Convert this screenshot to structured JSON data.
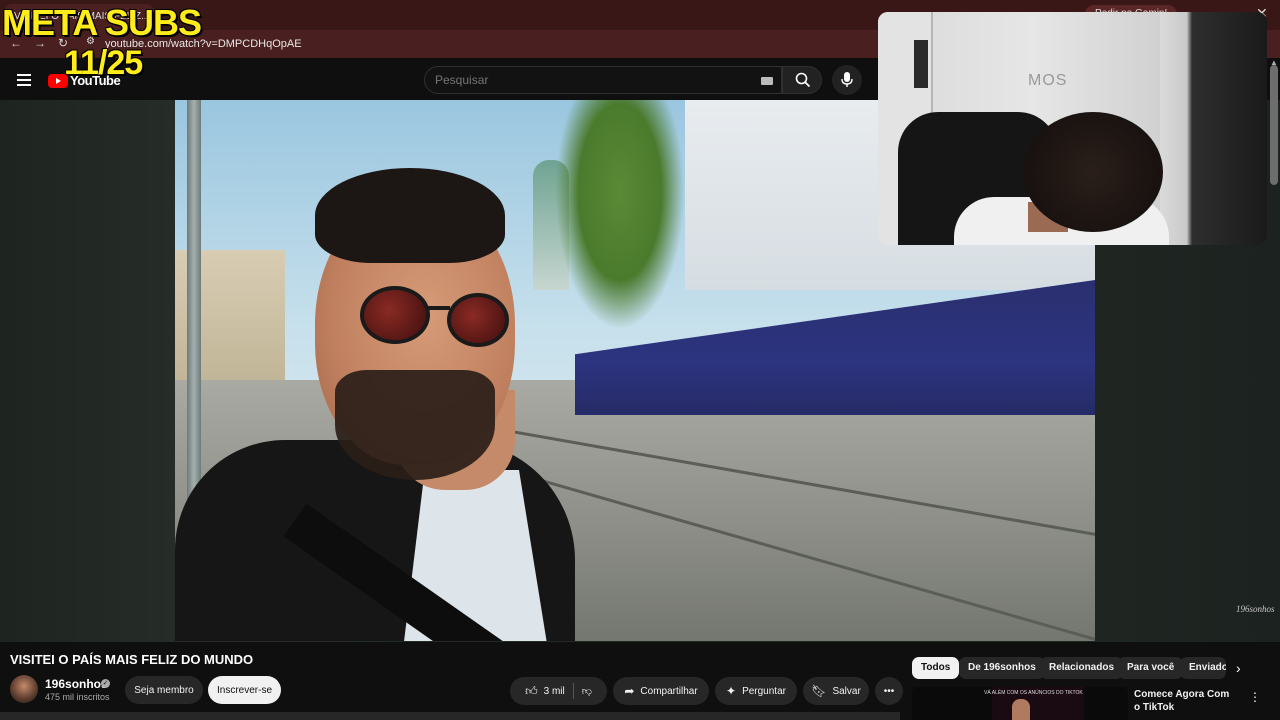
{
  "browser": {
    "tab_label": "VISITEI O PAÍS MAIS FELIZ...",
    "right_tab_label": "Pedir no Gamin!",
    "url": "youtube.com/watch?v=DMPCDHqOpAE"
  },
  "overlay": {
    "title": "META SUBS",
    "count": "11/25"
  },
  "header": {
    "logo_text": "YouTube",
    "search_placeholder": "Pesquisar"
  },
  "video": {
    "watermark": "196sonhos",
    "webcam_logo": "MOS"
  },
  "meta": {
    "title": "VISITEI O PAÍS MAIS FELIZ DO MUNDO",
    "channel": "196sonhos",
    "subscribers": "475 mil inscritos",
    "join_label": "Seja membro",
    "subscribe_label": "Inscrever-se",
    "likes": "3 mil",
    "share_label": "Compartilhar",
    "ask_label": "Perguntar",
    "save_label": "Salvar"
  },
  "chips": [
    "Todos",
    "De 196sonhos",
    "Relacionados",
    "Para você",
    "Enviados"
  ],
  "recommended": {
    "title": "Comece Agora Com o TikTok",
    "thumb_text": "VÁ ALÉM COM OS ANÚNCIOS DO TIKTOK"
  },
  "colors": {
    "accent_red": "#ff0000",
    "overlay_yellow": "#ffec1a",
    "browser_chrome": "#4a1f1f"
  }
}
